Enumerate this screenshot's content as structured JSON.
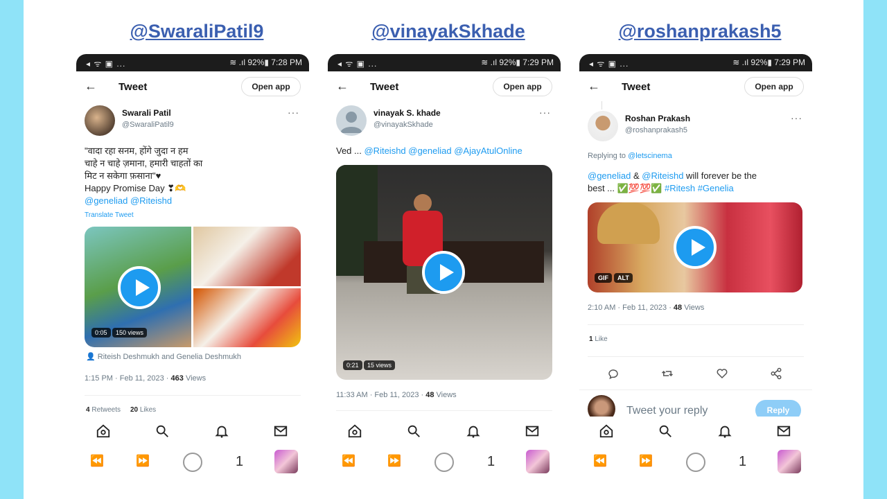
{
  "handles": [
    "@SwaraliPatil9",
    "@vinayakSkhade",
    "@roshanprakash5"
  ],
  "phones": [
    {
      "status_left": "◂ ᯤ ▣ ...",
      "status_right": "≋ .ıl 92%▮ 7:28 PM",
      "back": "←",
      "title": "Tweet",
      "open_app": "Open app",
      "name": "Swarali Patil",
      "username": "@SwaraliPatil9",
      "more": "···",
      "text_lines": [
        "\"वादा रहा सनम, होंगे जुदा न हम",
        "चाहे न चाहे ज़माना, हमारी चाहतों का",
        "मिट न सकेगा फ़साना\"♥"
      ],
      "promise": "Happy Promise Day ❣🫶",
      "mentions": "@geneliad @Riteishd",
      "translate": "Translate Tweet",
      "video_time": "0:05",
      "video_views": "150 views",
      "tagged": "Riteish Deshmukh and Genelia Deshmukh",
      "timestamp": "1:15 PM · Feb 11, 2023 · ",
      "views_count": "463",
      "views_label": " Views",
      "retweets_count": "4",
      "retweets_label": " Retweets",
      "likes_count": "20",
      "likes_label": " Likes"
    },
    {
      "status_left": "◂ ᯤ ▣ ...",
      "status_right": "≋ .ıl 92%▮ 7:29 PM",
      "back": "←",
      "title": "Tweet",
      "open_app": "Open app",
      "name": "vinayak S. khade",
      "username": "@vinayakSkhade",
      "more": "···",
      "text": "Ved ... ",
      "mentions": "@Riteishd @geneliad @AjayAtulOnline",
      "video_time": "0:21",
      "video_views": "15 views",
      "timestamp": "11:33 AM · Feb 11, 2023 · ",
      "views_count": "48",
      "views_label": " Views"
    },
    {
      "status_left": "◂ ᯤ ▣ ...",
      "status_right": "≋ .ıl 92%▮ 7:29 PM",
      "back": "←",
      "title": "Tweet",
      "open_app": "Open app",
      "name": "Roshan Prakash",
      "username": "@roshanprakash5",
      "more": "···",
      "replying_prefix": "Replying to ",
      "replying_to": "@letscinema",
      "mention1": "@geneliad",
      "amp": " & ",
      "mention2": "@Riteishd",
      "text_tail": " will forever be the",
      "line2_prefix": "best ... ✅💯💯✅ ",
      "hashtags": "#Ritesh #Genelia",
      "gif_badge": "GIF",
      "alt_badge": "ALT",
      "timestamp": "2:10 AM · Feb 11, 2023 · ",
      "views_count": "48",
      "views_label": " Views",
      "likes_count": "1",
      "likes_label": " Like",
      "reply_placeholder": "Tweet your reply",
      "reply_button": "Reply"
    }
  ],
  "system_bar": {
    "count": "1"
  },
  "colors": {
    "accent": "#1d9bf0",
    "handle": "#3b5fb0",
    "background": "#8fe3f8"
  },
  "icons": {
    "nav": [
      "home-icon",
      "search-icon",
      "bell-icon",
      "mail-icon"
    ],
    "actions": [
      "reply-icon",
      "retweet-icon",
      "like-icon",
      "share-icon"
    ]
  }
}
